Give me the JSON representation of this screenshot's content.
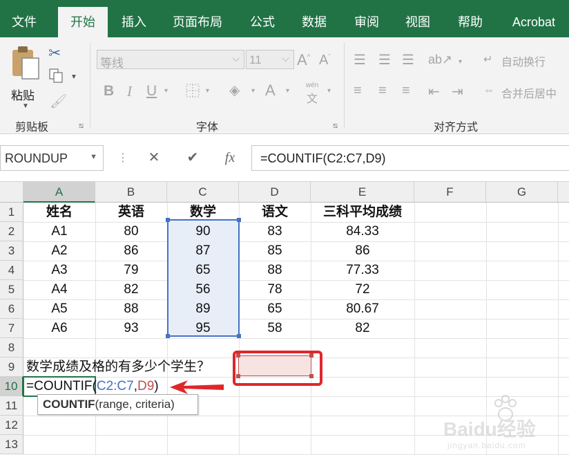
{
  "tabs": [
    "文件",
    "开始",
    "插入",
    "页面布局",
    "公式",
    "数据",
    "审阅",
    "视图",
    "帮助",
    "Acrobat"
  ],
  "active_tab": "开始",
  "ribbon": {
    "clipboard": {
      "paste_label": "粘贴",
      "group_label": "剪贴板"
    },
    "font": {
      "font_name": "等线",
      "font_size": "11",
      "group_label": "字体",
      "wen_glyph": "文",
      "wen_pinyin": "wén"
    },
    "alignment": {
      "wrap_text": "自动换行",
      "merge_center": "合并后居中",
      "group_label": "对齐方式"
    }
  },
  "formula_bar": {
    "name_box": "ROUNDUP",
    "cancel": "✕",
    "enter": "✔",
    "fx": "fx",
    "formula": "=COUNTIF(C2:C7,D9)"
  },
  "sheet": {
    "columns": [
      "A",
      "B",
      "C",
      "D",
      "E",
      "F",
      "G"
    ],
    "rows": [
      "1",
      "2",
      "3",
      "4",
      "5",
      "6",
      "7",
      "8",
      "9",
      "10",
      "11",
      "12",
      "13"
    ],
    "header_row": [
      "姓名",
      "英语",
      "数学",
      "语文",
      "三科平均成绩"
    ],
    "data_rows": [
      [
        "A1",
        "80",
        "90",
        "83",
        "84.33"
      ],
      [
        "A2",
        "86",
        "87",
        "85",
        "86"
      ],
      [
        "A3",
        "79",
        "65",
        "88",
        "77.33"
      ],
      [
        "A4",
        "82",
        "56",
        "78",
        "72"
      ],
      [
        "A5",
        "88",
        "89",
        "65",
        "80.67"
      ],
      [
        "A6",
        "93",
        "95",
        "58",
        "82"
      ]
    ],
    "question": "数学成绩及格的有多少个学生？",
    "formula_cell": {
      "prefix": "=COUNTIF(",
      "range": "C2:C7",
      "comma": ",",
      "ref": "D9",
      "suffix": ")"
    },
    "tooltip": {
      "func": "COUNTIF",
      "args": "(range, criteria)"
    }
  },
  "colors": {
    "excel_green": "#217346",
    "range_blue": "#4472c4",
    "ref_red": "#c0504d",
    "annotation_red": "#e0262a"
  },
  "watermark": {
    "brand": "Baidu经验",
    "url": "jingyan.baidu.com"
  }
}
